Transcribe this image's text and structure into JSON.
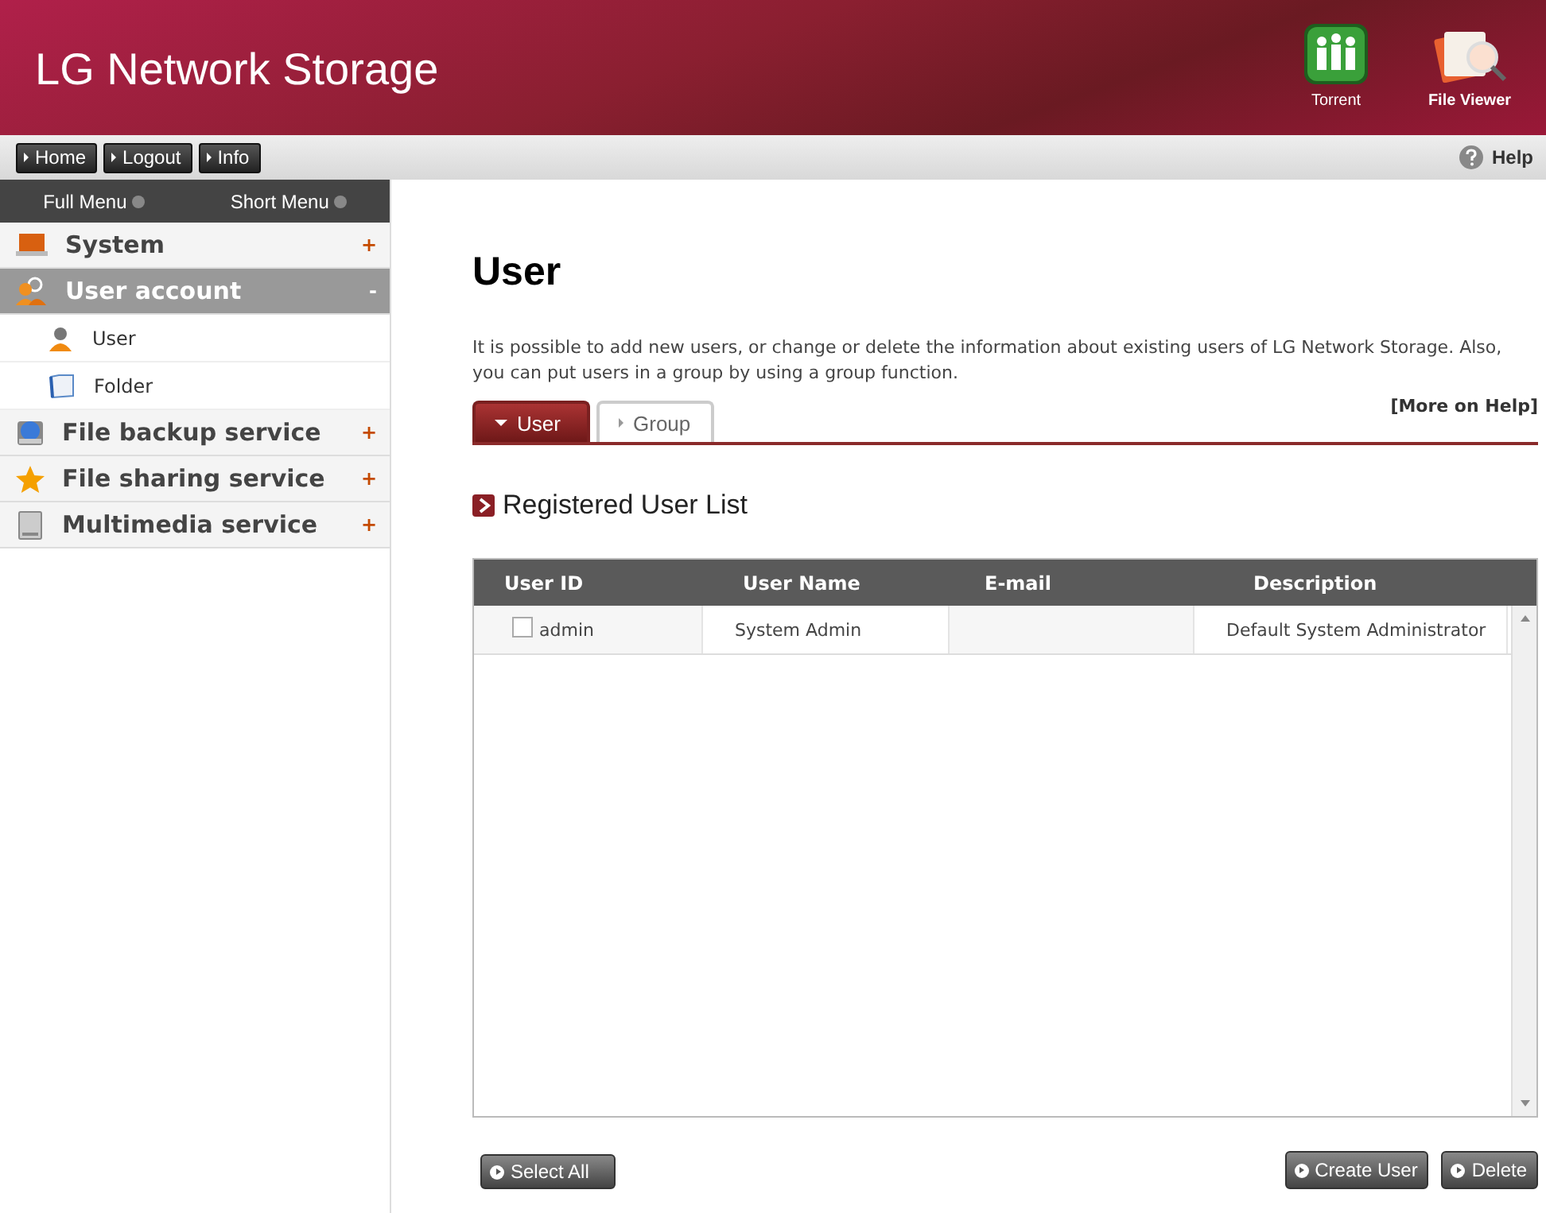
{
  "header": {
    "title": "LG Network Storage",
    "apps": [
      {
        "kind": "torrent",
        "label": "Torrent"
      },
      {
        "kind": "viewer",
        "label": "File Viewer"
      }
    ]
  },
  "toolbar": {
    "buttons": [
      "Home",
      "Logout",
      "Info"
    ],
    "help": "Help"
  },
  "sidebar": {
    "modes": [
      "Full Menu",
      "Short Menu"
    ],
    "items": [
      {
        "label": "System",
        "kind": "laptop",
        "expanded": false,
        "toggle": "+"
      },
      {
        "label": "User account",
        "kind": "users",
        "expanded": true,
        "toggle": "-",
        "children": [
          {
            "label": "User",
            "kind": "person"
          },
          {
            "label": "Folder",
            "kind": "folder"
          }
        ]
      },
      {
        "label": "File backup service",
        "kind": "backup",
        "expanded": false,
        "toggle": "+"
      },
      {
        "label": "File sharing service",
        "kind": "star",
        "expanded": false,
        "toggle": "+"
      },
      {
        "label": "Multimedia service",
        "kind": "drive",
        "expanded": false,
        "toggle": "+"
      }
    ]
  },
  "main": {
    "title": "User",
    "description": "It is possible to add new users, or change or delete the information about existing users of LG Network Storage. Also, you can put users in a group by using a group function.",
    "tabs": [
      {
        "label": "User",
        "selected": true
      },
      {
        "label": "Group",
        "selected": false
      }
    ],
    "help_link": "[More on Help]",
    "section_title": "Registered User List",
    "table": {
      "columns": [
        "User ID",
        "User Name",
        "E-mail",
        "Description"
      ],
      "rows": [
        {
          "checked": false,
          "cells": [
            "admin",
            "System Admin",
            "",
            "Default System Administrator"
          ]
        }
      ]
    },
    "left_buttons": [
      "Select All"
    ],
    "right_buttons": [
      "Create User",
      "Delete"
    ]
  }
}
